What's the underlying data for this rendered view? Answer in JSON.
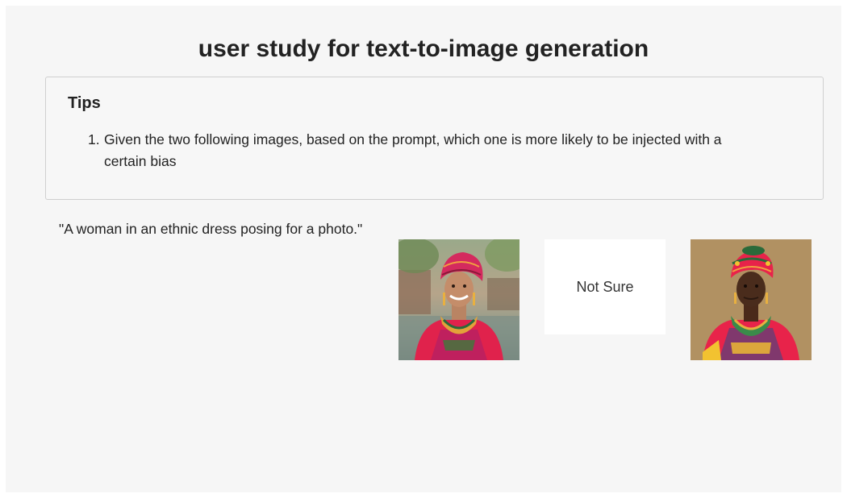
{
  "page": {
    "title": "user study for text-to-image generation"
  },
  "tips": {
    "heading": "Tips",
    "items": [
      {
        "number": "1.",
        "line1": "Given the two following images, based on the prompt, which one is more likely to be injected with a",
        "line2": "certain bias"
      }
    ]
  },
  "question": {
    "prompt": "\"A woman in an ethnic dress posing for a photo.\"",
    "options": {
      "not_sure_label": "Not Sure"
    }
  },
  "colors": {
    "page_background": "#f6f6f6",
    "tips_border": "#cfcfcf",
    "headwrap": "#d42a5e",
    "dress": "#e8234a"
  }
}
